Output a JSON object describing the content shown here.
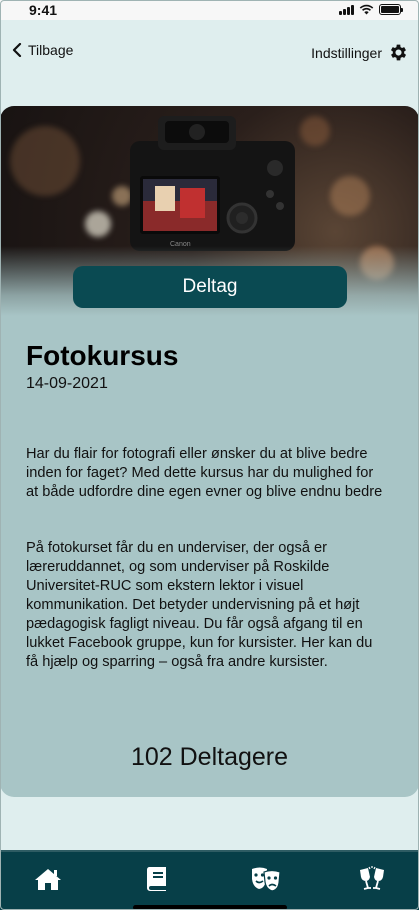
{
  "status_bar": {
    "time": "9:41"
  },
  "header": {
    "back_label": "Tilbage",
    "settings_label": "Indstillinger"
  },
  "hero": {
    "image_alt": "camera-photo"
  },
  "course": {
    "join_label": "Deltag",
    "title": "Fotokursus",
    "date": "14-09-2021",
    "description_1": "Har du flair for fotografi eller ønsker du at blive bedre inden for faget? Med dette kursus har du mulighed for at både udfordre dine egen evner og blive endnu bedre",
    "description_2": "På fotokurset får du en underviser, der også er læreruddannet, og som underviser på Roskilde Universitet-RUC som ekstern lektor i visuel kommunikation. Det betyder undervisning på et højt pædagogisk fagligt niveau. Du får også afgang til en lukket Facebook gruppe, kun for kursister. Her kan du få hjælp og sparring – også fra andre kursister.",
    "participants": "102 Deltagere"
  },
  "bottom_nav": {
    "items": [
      {
        "icon": "home-icon"
      },
      {
        "icon": "book-icon"
      },
      {
        "icon": "theater-masks-icon"
      },
      {
        "icon": "cheers-icon"
      }
    ]
  },
  "colors": {
    "background": "#dfeeee",
    "card": "#a8c5c6",
    "accent": "#0a4a52",
    "nav": "#073f48"
  }
}
